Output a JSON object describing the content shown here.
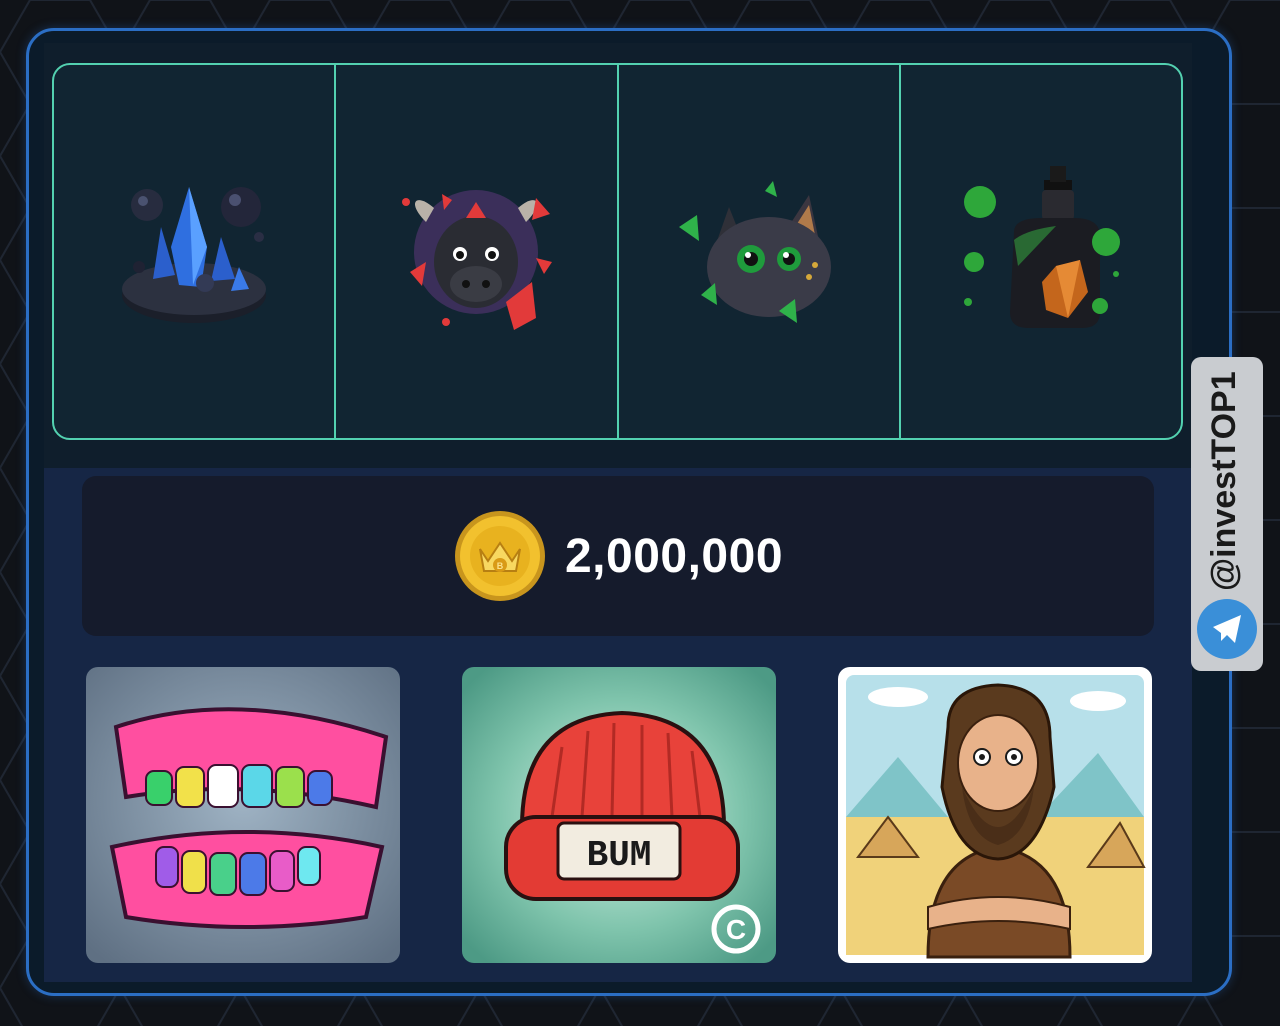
{
  "price": {
    "amount": "2,000,000"
  },
  "watermark": {
    "handle": "@investTOP1"
  },
  "tiles": {
    "bum_badge": "BUM"
  },
  "colors": {
    "frame_border": "#2b6ec4",
    "grid_border": "#53d1b0",
    "coin": "#f2c12e",
    "price_bg": "#151b2c"
  }
}
